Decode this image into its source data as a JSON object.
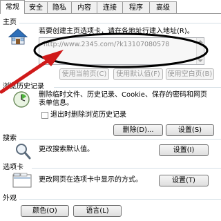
{
  "tabs": [
    {
      "label": "常规",
      "active": true
    },
    {
      "label": "安全"
    },
    {
      "label": "隐私"
    },
    {
      "label": "内容"
    },
    {
      "label": "连接"
    },
    {
      "label": "程序"
    },
    {
      "label": "高级"
    }
  ],
  "home": {
    "title": "主页",
    "description": "若要创建主页选项卡，请在各地址行建入地址(R)。",
    "url": "http://www.2345.com/?k13107080578",
    "use_current": "使用当前页(C)",
    "use_default": "使用默认值(F)",
    "use_blank": "使用空白页(B)"
  },
  "history": {
    "title": "浏览历史记录",
    "description_line1": "删除临时文件、历史记录、Cookie、保存的密码和网页",
    "description_line2": "表单信息。",
    "checkbox_label": "退出时删除浏览历史记录",
    "delete_button": "删除(D)...",
    "settings_button": "设置(S)"
  },
  "search": {
    "title": "搜索",
    "description": "更改搜索默认值。",
    "settings_button": "设置(I)"
  },
  "tabs_section": {
    "title": "选项卡",
    "description": "更改网页在选项卡中显示的方式。",
    "settings_button": "设置(T)"
  },
  "appearance": {
    "title": "外观",
    "colors_button": "颜色(O)",
    "languages_button": "语言(L)"
  },
  "annotation": {
    "color": "#d01a1a",
    "ellipse_color": "#000000"
  }
}
